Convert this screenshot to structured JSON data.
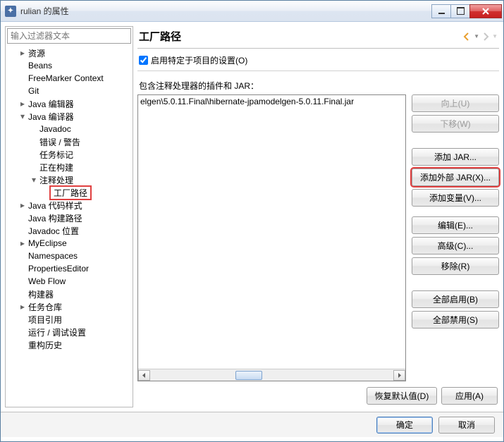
{
  "window": {
    "title": "rulian 的属性"
  },
  "sidebar": {
    "filter_placeholder": "输入过滤器文本",
    "items": [
      {
        "label": "资源",
        "indent": 1,
        "arrow": "right"
      },
      {
        "label": "Beans",
        "indent": 1,
        "arrow": "blank"
      },
      {
        "label": "FreeMarker Context",
        "indent": 1,
        "arrow": "blank"
      },
      {
        "label": "Git",
        "indent": 1,
        "arrow": "blank"
      },
      {
        "label": "Java 编辑器",
        "indent": 1,
        "arrow": "right"
      },
      {
        "label": "Java 编译器",
        "indent": 1,
        "arrow": "down"
      },
      {
        "label": "Javadoc",
        "indent": 2,
        "arrow": "blank"
      },
      {
        "label": "错误 / 警告",
        "indent": 2,
        "arrow": "blank"
      },
      {
        "label": "任务标记",
        "indent": 2,
        "arrow": "blank"
      },
      {
        "label": "正在构建",
        "indent": 2,
        "arrow": "blank"
      },
      {
        "label": "注释处理",
        "indent": 2,
        "arrow": "down"
      },
      {
        "label": "工厂路径",
        "indent": 3,
        "arrow": "blank",
        "selected": true
      },
      {
        "label": "Java 代码样式",
        "indent": 1,
        "arrow": "right"
      },
      {
        "label": "Java 构建路径",
        "indent": 1,
        "arrow": "blank"
      },
      {
        "label": "Javadoc 位置",
        "indent": 1,
        "arrow": "blank"
      },
      {
        "label": "MyEclipse",
        "indent": 1,
        "arrow": "right"
      },
      {
        "label": "Namespaces",
        "indent": 1,
        "arrow": "blank"
      },
      {
        "label": "PropertiesEditor",
        "indent": 1,
        "arrow": "blank"
      },
      {
        "label": "Web Flow",
        "indent": 1,
        "arrow": "blank"
      },
      {
        "label": "构建器",
        "indent": 1,
        "arrow": "blank"
      },
      {
        "label": "任务仓库",
        "indent": 1,
        "arrow": "right"
      },
      {
        "label": "项目引用",
        "indent": 1,
        "arrow": "blank"
      },
      {
        "label": "运行 / 调试设置",
        "indent": 1,
        "arrow": "blank"
      },
      {
        "label": "重构历史",
        "indent": 1,
        "arrow": "blank"
      }
    ]
  },
  "main": {
    "title": "工厂路径",
    "enable_project_label": "启用特定于项目的设置(O)",
    "enable_project_checked": true,
    "plugins_label": "包含注释处理器的插件和 JAR：",
    "list_entry": "elgen\\5.0.11.Final\\hibernate-jpamodelgen-5.0.11.Final.jar",
    "buttons": {
      "up": "向上(U)",
      "down": "下移(W)",
      "add_jar": "添加 JAR...",
      "add_external_jar": "添加外部 JAR(X)...",
      "add_variable": "添加变量(V)...",
      "edit": "编辑(E)...",
      "advanced": "高级(C)...",
      "remove": "移除(R)",
      "enable_all": "全部启用(B)",
      "disable_all": "全部禁用(S)"
    },
    "restore_defaults": "恢复默认值(D)",
    "apply": "应用(A)"
  },
  "footer": {
    "ok": "确定",
    "cancel": "取消"
  }
}
